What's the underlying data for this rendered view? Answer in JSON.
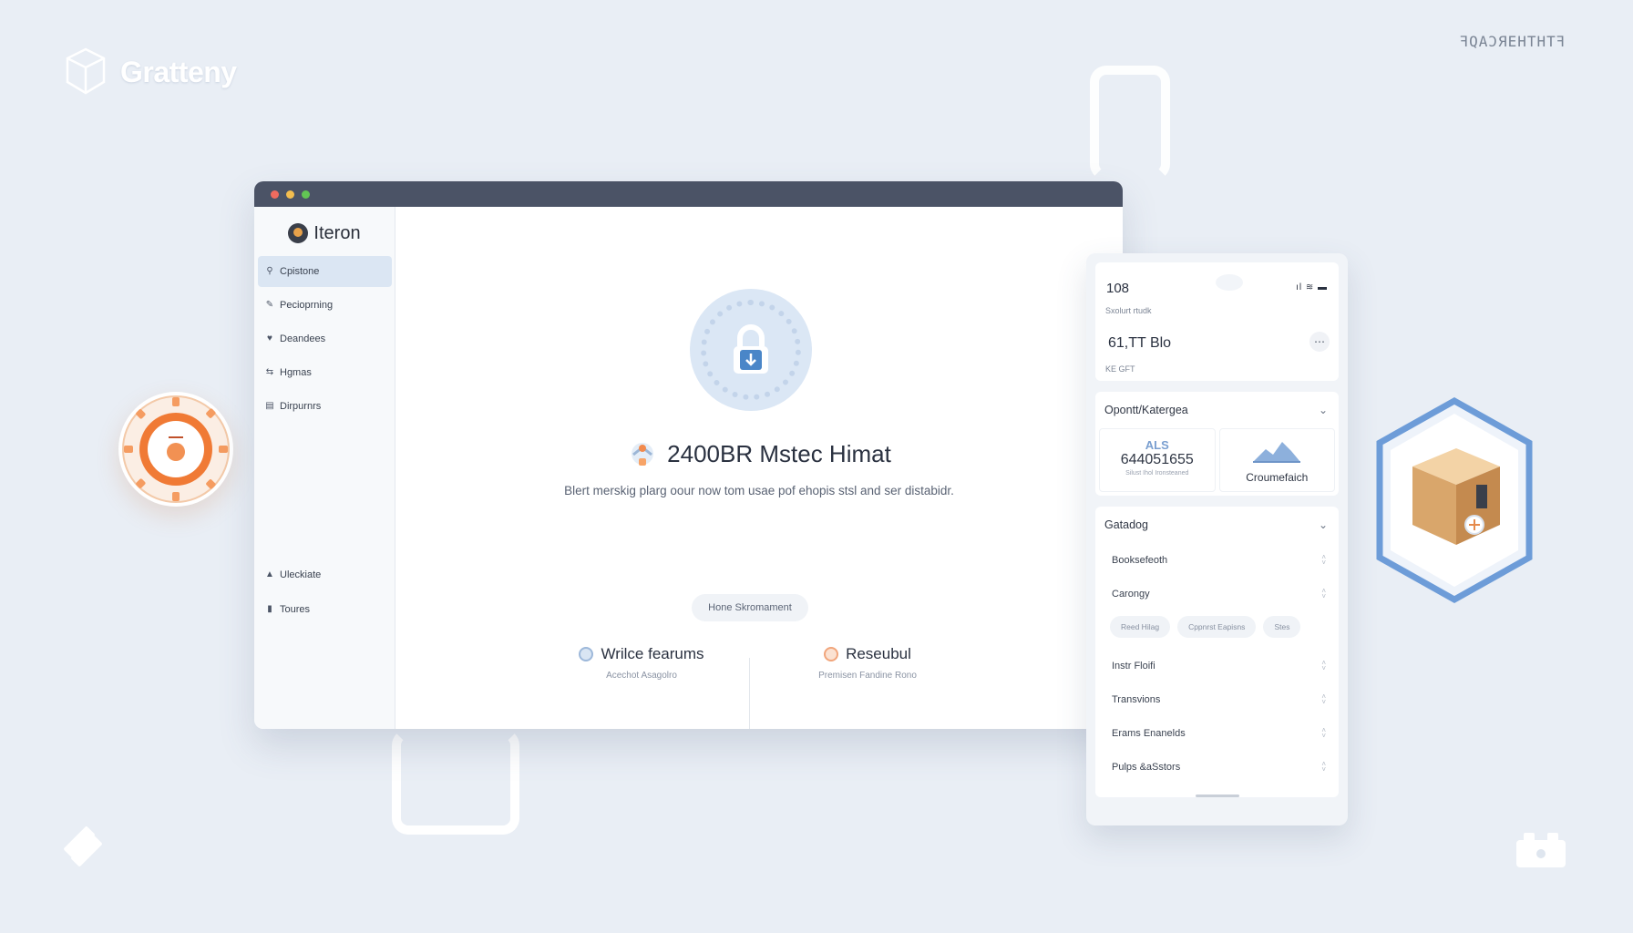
{
  "brand": {
    "name": "Gratteny"
  },
  "corner_label": "ꟻQAƆЯEHTHTꟻ",
  "window": {
    "sidebar": {
      "brand": "Iteron",
      "items": [
        {
          "label": "Cpistone",
          "icon": "search-icon"
        },
        {
          "label": "Pecioprning",
          "icon": "pen-icon"
        },
        {
          "label": "Deandees",
          "icon": "shield-icon"
        },
        {
          "label": "Hgmas",
          "icon": "flow-icon"
        },
        {
          "label": "Dirpurnrs",
          "icon": "document-icon"
        }
      ],
      "footer_items": [
        {
          "label": "Uleckiate",
          "icon": "lock-icon"
        },
        {
          "label": "Toures",
          "icon": "book-icon"
        }
      ]
    },
    "main": {
      "title": "2400BR Mstec Himat",
      "subtitle": "Blert merskig plarg oour now tom usae pof ehopis stsl and ser distabidr.",
      "pill": "Hone Skromament",
      "features": [
        {
          "title": "Wrilce fearums",
          "subtitle": "Acechot Asagolro"
        },
        {
          "title": "Reseubul",
          "subtitle": "Premisen Fandine Rono"
        }
      ]
    }
  },
  "phone": {
    "time": "108",
    "account_label": "Sxolurt rtudk",
    "balance": "61,TT Blo",
    "account_sub": "KE GFT",
    "section1": {
      "title": "Opontt/Katergea",
      "tile1": {
        "label": "ALS",
        "value": "644051655",
        "caption": "Silust Ihol Ironsteaned"
      },
      "tile2": {
        "label": "Croumefaich"
      }
    },
    "section2": {
      "title": "Gatadog",
      "rows": [
        "Booksefeoth",
        "Carongy"
      ],
      "chips": [
        "Reed Hilag",
        "Cppnrst Eapisns",
        "Stes"
      ],
      "rows2": [
        "Instr Floifi",
        "Transvions",
        "Erams Enanelds",
        "Pulps &aSstors"
      ]
    }
  },
  "colors": {
    "accent_blue": "#7a9fd0",
    "accent_orange": "#f07a35",
    "titlebar": "#4b5366"
  }
}
